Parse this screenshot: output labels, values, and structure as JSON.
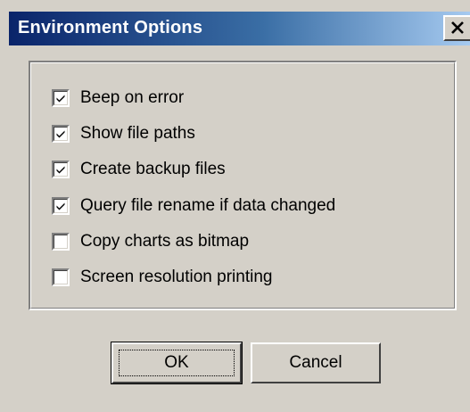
{
  "window": {
    "title": "Environment Options",
    "close_icon": "close-icon"
  },
  "options": [
    {
      "label": "Beep on error",
      "checked": true
    },
    {
      "label": "Show file paths",
      "checked": true
    },
    {
      "label": "Create backup files",
      "checked": true
    },
    {
      "label": "Query file rename if data changed",
      "checked": true
    },
    {
      "label": "Copy charts as bitmap",
      "checked": false
    },
    {
      "label": "Screen resolution printing",
      "checked": false
    }
  ],
  "buttons": {
    "ok_label": "OK",
    "cancel_label": "Cancel"
  },
  "colors": {
    "title_gradient_start": "#0a246a",
    "title_gradient_end": "#a6caf0",
    "face": "#d4d0c8"
  }
}
